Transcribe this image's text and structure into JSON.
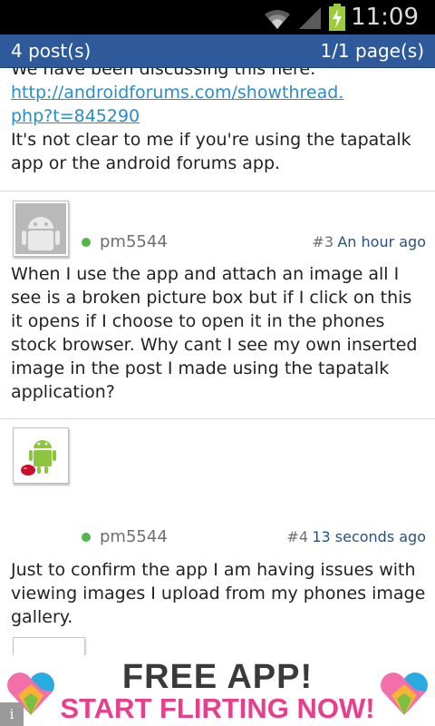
{
  "status_bar": {
    "time": "11:09",
    "icons": [
      "wifi-icon",
      "signal-icon",
      "battery-charging-icon"
    ]
  },
  "header": {
    "post_count": "4 post(s)",
    "page_count": "1/1 page(s)"
  },
  "previous_post": {
    "cut_line": "We have been discussing this here:",
    "link": "http://androidforums.com/showthread.php?t=845290",
    "link_line1": "http://androidforums.com/showthread.",
    "link_line2": "php?t=845290",
    "text": "It's not clear to me if you're using the tapatalk app or the android forums app."
  },
  "posts": [
    {
      "username": "pm5544",
      "number": "#3",
      "time": "An hour ago",
      "avatar": "default-android-avatar",
      "body": "When I use the app and attach an image all I see is a broken picture box but if I click on this it opens if I choose to open it in the phones stock browser. Why cant I see my own inserted image in the post I made using the tapatalk application?"
    },
    {
      "username": "pm5544",
      "number": "#4",
      "time": "13 seconds ago",
      "avatar": "android-jellybean-avatar",
      "body": "Just to confirm the app I am having issues with viewing images I upload from my phones image gallery.",
      "attachment": "broken-image-icon"
    }
  ],
  "ad": {
    "line1": "FREE APP!",
    "line2": "START FLIRTING NOW!",
    "info": "i"
  },
  "colors": {
    "header_bg": "#2e5a9c",
    "online": "#4fb848",
    "link": "#2a8cc8",
    "ad_pink": "#e83e8c"
  }
}
